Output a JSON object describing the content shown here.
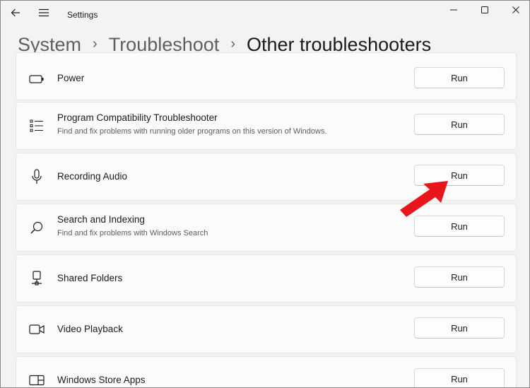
{
  "window": {
    "app_title": "Settings",
    "back_icon": "arrow-left-icon",
    "menu_icon": "hamburger-menu-icon",
    "controls": [
      "minimize-icon",
      "maximize-icon",
      "close-icon"
    ]
  },
  "breadcrumb": {
    "items": [
      "System",
      "Troubleshoot",
      "Other troubleshooters"
    ],
    "separator": "›"
  },
  "troubleshooters": [
    {
      "name": "Power",
      "description": "",
      "icon": "battery-icon",
      "button": "Run"
    },
    {
      "name": "Program Compatibility Troubleshooter",
      "description": "Find and fix problems with running older programs on this version of Windows.",
      "icon": "list-icon",
      "button": "Run"
    },
    {
      "name": "Recording Audio",
      "description": "",
      "icon": "microphone-icon",
      "button": "Run"
    },
    {
      "name": "Search and Indexing",
      "description": "Find and fix problems with Windows Search",
      "icon": "search-icon",
      "button": "Run"
    },
    {
      "name": "Shared Folders",
      "description": "",
      "icon": "network-drive-icon",
      "button": "Run"
    },
    {
      "name": "Video Playback",
      "description": "",
      "icon": "video-camera-icon",
      "button": "Run"
    },
    {
      "name": "Windows Store Apps",
      "description": "",
      "icon": "app-window-icon",
      "button": "Run"
    }
  ],
  "annotation": {
    "icon": "red-arrow-icon",
    "color": "#e8161b",
    "target": "Recording Audio"
  },
  "colors": {
    "background": "#f3f3f3",
    "card": "#fbfbfb",
    "arrow": "#e8161b"
  }
}
